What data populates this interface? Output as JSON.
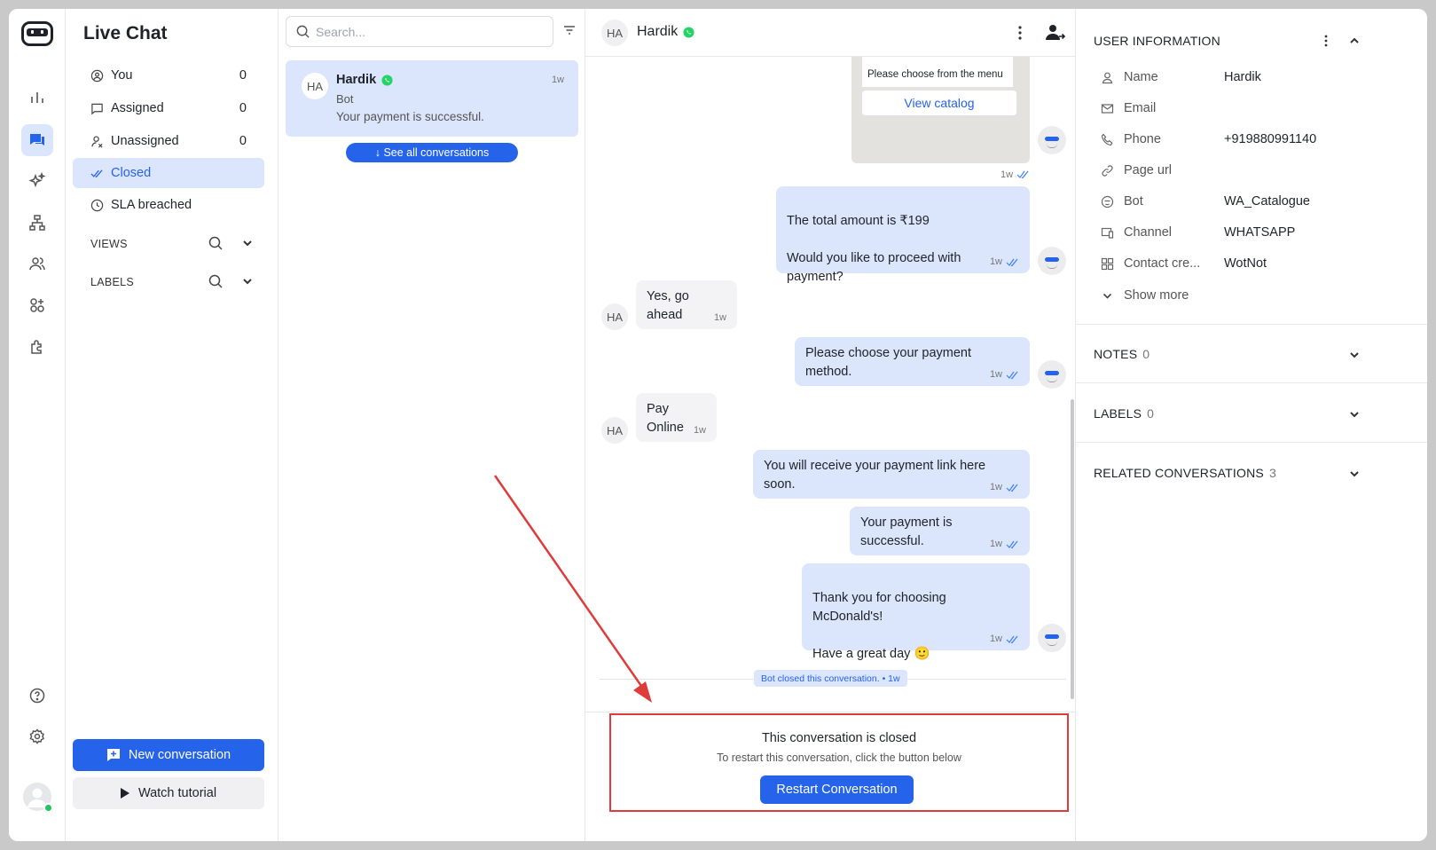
{
  "app": {
    "section_title": "Live Chat"
  },
  "nav": {
    "items": [
      {
        "label": "You",
        "count": "0"
      },
      {
        "label": "Assigned",
        "count": "0"
      },
      {
        "label": "Unassigned",
        "count": "0"
      },
      {
        "label": "Closed",
        "count": ""
      },
      {
        "label": "SLA breached",
        "count": ""
      }
    ],
    "views_label": "VIEWS",
    "labels_label": "LABELS",
    "new_conversation": "New conversation",
    "watch_tutorial": "Watch tutorial"
  },
  "list": {
    "search_placeholder": "Search...",
    "conversation": {
      "initials": "HA",
      "name": "Hardik",
      "subtitle": "Bot",
      "preview": "Your payment is successful.",
      "time": "1w"
    },
    "see_all": "↓ See all conversations"
  },
  "chat": {
    "initials": "HA",
    "name": "Hardik",
    "catalog_text": "Please choose from the menu",
    "catalog_button": "View catalog",
    "catalog_time": "1w",
    "messages": [
      {
        "text": "The total amount is ₹199\n\nWould you like to proceed with payment?",
        "time": "1w"
      },
      {
        "text": "Yes, go ahead",
        "time": "1w"
      },
      {
        "text": "Please choose your payment method.",
        "time": "1w"
      },
      {
        "text": "Pay Online",
        "time": "1w"
      },
      {
        "text": "You will receive your payment link here soon.",
        "time": "1w"
      },
      {
        "text": "Your payment is successful.",
        "time": "1w"
      },
      {
        "text": "Thank you for choosing McDonald's!\n\nHave a great day 🙂",
        "time": "1w"
      }
    ],
    "closed_notice": "Bot closed this conversation. • 1w",
    "closed_title": "This conversation is closed",
    "closed_subtitle": "To restart this conversation, click the button below",
    "restart_button": "Restart Conversation"
  },
  "info": {
    "title": "USER INFORMATION",
    "fields": [
      {
        "label": "Name",
        "value": "Hardik"
      },
      {
        "label": "Email",
        "value": ""
      },
      {
        "label": "Phone",
        "value": "+919880991140"
      },
      {
        "label": "Page url",
        "value": ""
      },
      {
        "label": "Bot",
        "value": "WA_Catalogue"
      },
      {
        "label": "Channel",
        "value": "WHATSAPP"
      },
      {
        "label": "Contact cre...",
        "value": "WotNot"
      }
    ],
    "show_more": "Show more",
    "notes_label": "NOTES",
    "notes_count": "0",
    "labels_label": "LABELS",
    "labels_count": "0",
    "related_label": "RELATED CONVERSATIONS",
    "related_count": "3"
  },
  "colors": {
    "accent": "#2563eb",
    "accent_light": "#dbe5fb",
    "annotation_red": "#e03b3b",
    "online": "#22c55e",
    "whatsapp": "#25d366"
  }
}
